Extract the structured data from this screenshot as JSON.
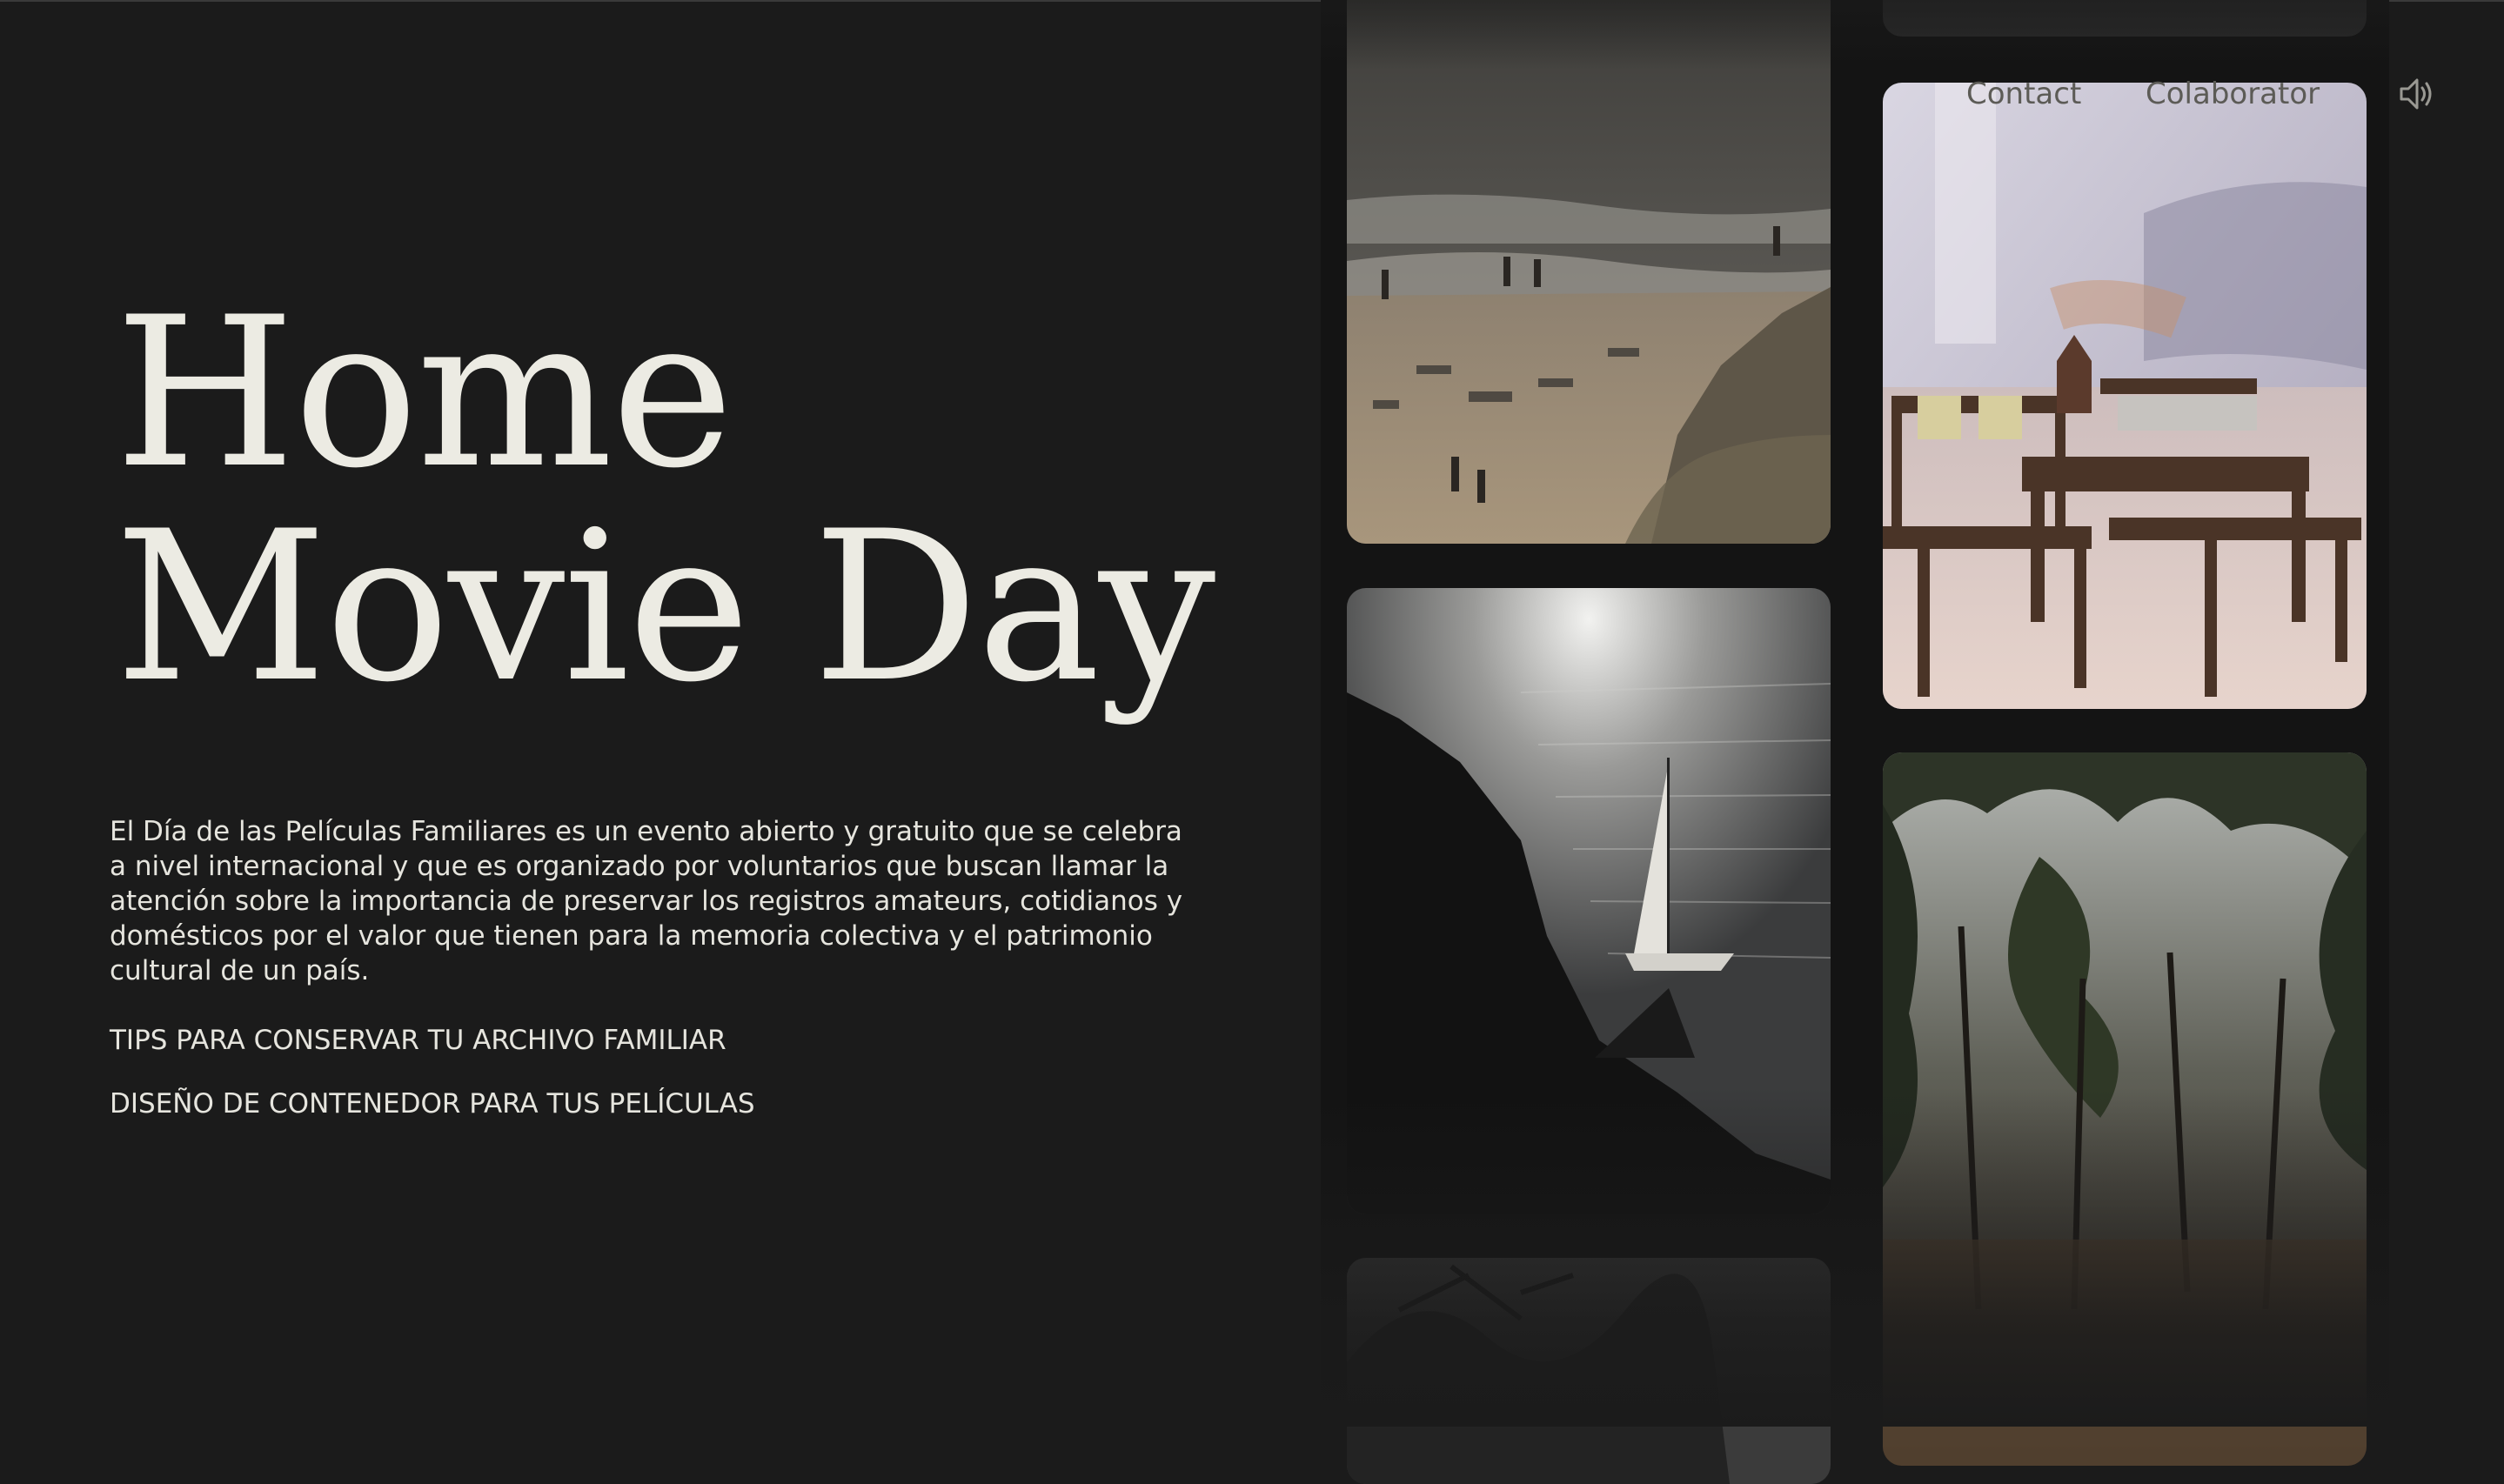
{
  "header": {
    "nav": [
      {
        "label": "Contact"
      },
      {
        "label": "Colaborator"
      }
    ],
    "sound_icon": "speaker-sound-icon"
  },
  "hero": {
    "title_line1": "Home",
    "title_line2": "Movie Day",
    "intro": "El Día de las Películas Familiares es un evento abierto y gratuito que se celebra a nivel internacional y que es organizado por voluntarios que buscan llamar la atención sobre la importancia de preservar los registros amateurs, cotidianos y domésticos por el valor que tienen para la memoria colectiva y el patrimonio cultural de un país."
  },
  "links": [
    {
      "label": "TIPS PARA CONSERVAR TU ARCHIVO FAMILIAR"
    },
    {
      "label": "DISEÑO DE CONTENEDOR PARA TUS PELÍCULAS"
    }
  ],
  "colors": {
    "background": "#1b1b1b",
    "text": "#ecebe4",
    "nav_text": "#5c5b56"
  }
}
